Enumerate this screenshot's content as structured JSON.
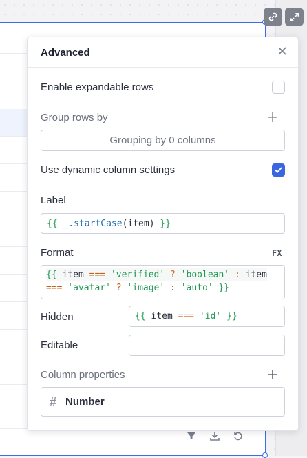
{
  "panel": {
    "title": "Advanced",
    "expandable_rows_label": "Enable expandable rows",
    "expandable_rows_checked": false,
    "group_rows_label": "Group rows by",
    "grouping_placeholder": "Grouping by 0 columns",
    "dynamic_columns_label": "Use dynamic column settings",
    "dynamic_columns_checked": true,
    "label_label": "Label",
    "label_value_open": "{{",
    "label_value_fn": " _.startCase",
    "label_value_args": "(item)",
    "label_value_close": " }}",
    "format_label": "Format",
    "fx_label": "FX",
    "format_line1": {
      "open": "{{",
      "v1": " item ",
      "op1": "===",
      "s1": " 'verified'",
      "op2": " ?",
      "s2": " 'boolean'",
      "op3": " :",
      "v2": " item"
    },
    "format_line2": {
      "op1": "===",
      "s1": " 'avatar'",
      "op2": " ?",
      "s2": " 'image'",
      "op3": " :",
      "s3": " 'auto'",
      "close": " }}"
    },
    "hidden_label": "Hidden",
    "hidden_value": {
      "open": "{{",
      "v1": " item ",
      "op1": "===",
      "s1": " 'id'",
      "close": " }}"
    },
    "editable_label": "Editable",
    "editable_value": "",
    "column_properties_label": "Column properties",
    "column_type_icon": "#",
    "column_type_label": "Number"
  },
  "toolbar": {
    "link_icon": "link-icon",
    "expand_icon": "expand-icon"
  },
  "table_footer": {
    "icons": [
      "filter-icon",
      "download-icon",
      "refresh-icon"
    ]
  },
  "colors": {
    "accent": "#3a66e0",
    "selection_border": "#3b6de8",
    "code_green": "#1f9a52",
    "code_orange": "#c2631a"
  }
}
